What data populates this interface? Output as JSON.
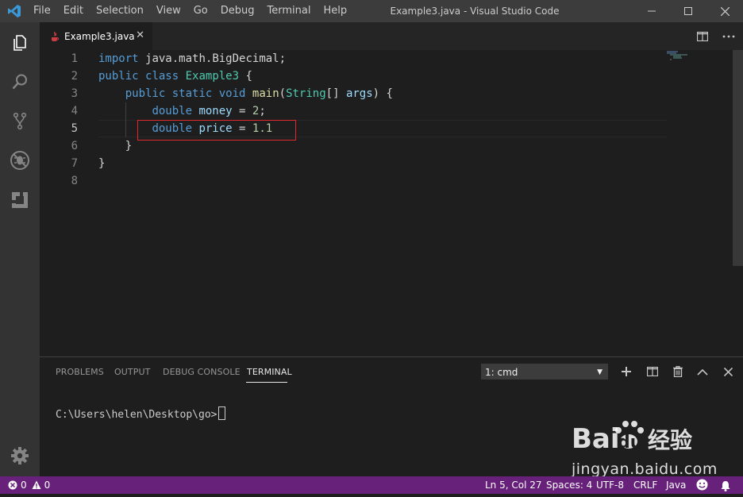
{
  "window": {
    "title": "Example3.java - Visual Studio Code",
    "menu": [
      "File",
      "Edit",
      "Selection",
      "View",
      "Go",
      "Debug",
      "Terminal",
      "Help"
    ]
  },
  "activity_bar": {
    "icons": [
      "explorer-icon",
      "search-icon",
      "source-control-icon",
      "debug-icon",
      "extensions-icon",
      "settings-gear-icon"
    ]
  },
  "tabs": [
    {
      "label": "Example3.java",
      "active": true
    }
  ],
  "editor": {
    "active_line": 5,
    "line_numbers": [
      "1",
      "2",
      "3",
      "4",
      "5",
      "6",
      "7",
      "8"
    ],
    "lines": [
      "import java.math.BigDecimal;",
      "public class Example3 {",
      "    public static void main(String[] args) {",
      "        double money = 2;",
      "        double price = 1.1",
      "    }",
      "}",
      ""
    ],
    "highlighted_line": 5
  },
  "panel": {
    "tabs": [
      "PROBLEMS",
      "OUTPUT",
      "DEBUG CONSOLE",
      "TERMINAL"
    ],
    "active_tab": "TERMINAL",
    "terminal_select": "1: cmd",
    "terminal_prompt": "C:\\Users\\helen\\Desktop\\go>"
  },
  "status_bar": {
    "errors": "0",
    "warnings": "0",
    "position": "Ln 5, Col 27",
    "spaces": "Spaces: 4",
    "encoding": "UTF-8",
    "eol": "CRLF",
    "language": "Java",
    "background": "#68217a"
  },
  "watermark": {
    "brand": "Bai",
    "brand2": "du",
    "brand_cn": "经验",
    "url": "jingyan.baidu.com"
  }
}
